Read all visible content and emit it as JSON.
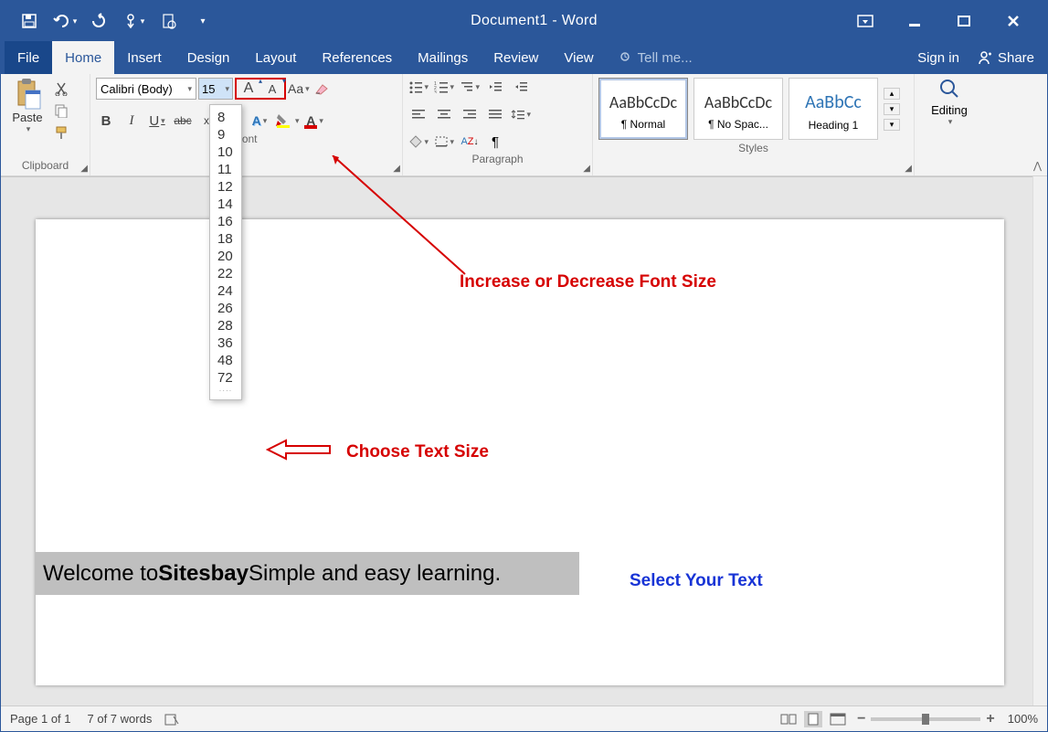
{
  "title": "Document1 - Word",
  "tabs": {
    "file": "File",
    "home": "Home",
    "insert": "Insert",
    "design": "Design",
    "layout": "Layout",
    "references": "References",
    "mailings": "Mailings",
    "review": "Review",
    "view": "View",
    "tellme": "Tell me...",
    "signin": "Sign in",
    "share": "Share"
  },
  "ribbon": {
    "clipboard": {
      "paste": "Paste",
      "label": "Clipboard"
    },
    "font": {
      "name": "Calibri (Body)",
      "size": "15",
      "label": "Font",
      "sizes": [
        "8",
        "9",
        "10",
        "11",
        "12",
        "14",
        "16",
        "18",
        "20",
        "22",
        "24",
        "26",
        "28",
        "36",
        "48",
        "72"
      ]
    },
    "paragraph": {
      "label": "Paragraph"
    },
    "styles": {
      "label": "Styles",
      "items": [
        {
          "sample": "AaBbCcDc",
          "name": "¶ Normal"
        },
        {
          "sample": "AaBbCcDc",
          "name": "¶ No Spac..."
        },
        {
          "sample": "AaBbCc",
          "name": "Heading 1"
        }
      ]
    },
    "editing": {
      "label": "Editing"
    }
  },
  "annotations": {
    "increase": "Increase or Decrease Font Size",
    "choose": "Choose Text Size",
    "select": "Select Your Text"
  },
  "document": {
    "pre": "Welcome to ",
    "bold": "Sitesbay",
    "post": " Simple and easy learning."
  },
  "status": {
    "page": "Page 1 of 1",
    "words": "7 of 7 words",
    "zoom": "100%"
  }
}
